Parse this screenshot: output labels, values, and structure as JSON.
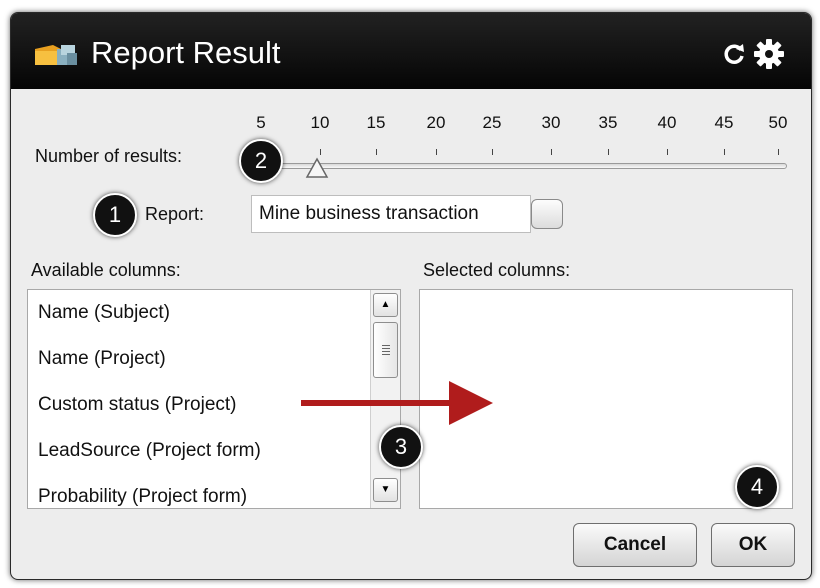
{
  "window": {
    "title": "Report Result",
    "icons": {
      "app": "folder-cubes-icon",
      "refresh": "refresh-icon",
      "settings": "gear-icon"
    }
  },
  "results": {
    "label": "Number of results:",
    "ticks": [
      "5",
      "10",
      "15",
      "20",
      "25",
      "30",
      "35",
      "40",
      "45",
      "50"
    ],
    "value": 10
  },
  "report": {
    "label": "Report:",
    "value": "Mine business transaction"
  },
  "available": {
    "label": "Available columns:",
    "items": [
      "Name (Subject)",
      "Name (Project)",
      "Custom status (Project)",
      "LeadSource (Project form)",
      "Probability (Project form)"
    ]
  },
  "selected": {
    "label": "Selected columns:",
    "items": []
  },
  "buttons": {
    "cancel": "Cancel",
    "ok": "OK"
  },
  "annotations": [
    "1",
    "2",
    "3",
    "4"
  ],
  "colors": {
    "titlebar": "#111111",
    "dialog_bg": "#ededed",
    "arrow": "#b01c1c",
    "badge": "#111111"
  }
}
